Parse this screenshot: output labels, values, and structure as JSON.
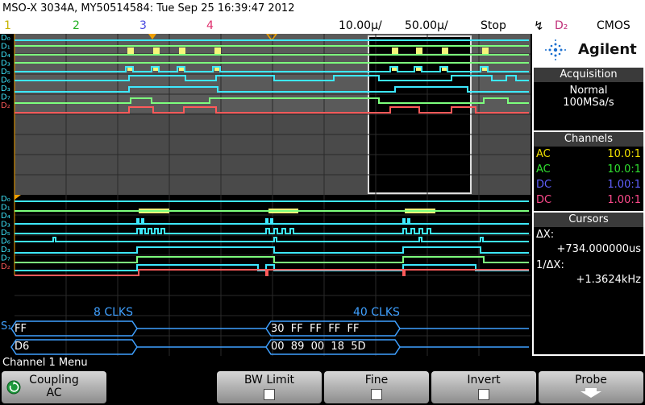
{
  "title_bar": {
    "text": "MSO-X 3034A, MY50514584: Tue Sep 25 16:39:47 2012"
  },
  "header": {
    "channels": [
      "1",
      "2",
      "3",
      "4"
    ],
    "channel_colors": [
      "#f0e000",
      "#30e030",
      "#6060ff",
      "#ff4a8c"
    ],
    "timebase": "10.00µ/",
    "delay": "50.00µ/",
    "run_state": "Stop",
    "trigger_symbol": "↯",
    "trigger_source": "D₂",
    "logic_family": "CMOS"
  },
  "digital_labels_upper": [
    "D₀",
    "D₁",
    "D₄",
    "D₃",
    "D₅",
    "D₆",
    "D₃",
    "D₇",
    "D₂"
  ],
  "digital_labels_lower": [
    "D₀",
    "D₁",
    "D₄",
    "D₃",
    "D₅",
    "D₆",
    "D₃",
    "D₇",
    "D₂"
  ],
  "brand": {
    "logo_text": "Agilent"
  },
  "acquisition": {
    "heading": "Acquisition",
    "mode": "Normal",
    "rate": "100MSa/s"
  },
  "channels_panel": {
    "heading": "Channels",
    "rows": [
      {
        "coupling": "AC",
        "probe": "10.0:1",
        "color": "#f0e000"
      },
      {
        "coupling": "AC",
        "probe": "10.0:1",
        "color": "#30e030"
      },
      {
        "coupling": "DC",
        "probe": "1.00:1",
        "color": "#6060ff"
      },
      {
        "coupling": "DC",
        "probe": "1.00:1",
        "color": "#ff4a8c"
      }
    ]
  },
  "cursors_panel": {
    "heading": "Cursors",
    "dx_label": "ΔX:",
    "dx_value": "+734.000000us",
    "inv_label": "1/ΔX:",
    "inv_value": "+1.3624kHz"
  },
  "bus": {
    "label": "S₁",
    "annotation_left": "8 CLKS",
    "annotation_right": "40 CLKS",
    "row1_left": "FF",
    "row1_right": "30  FF  FF  FF  FF",
    "row2_left": "D6",
    "row2_right": "00  89  00  18  5D"
  },
  "menu": {
    "title": "Channel 1 Menu"
  },
  "softkeys": [
    {
      "label": "Coupling",
      "value": "AC"
    },
    {
      "label": "BW Limit"
    },
    {
      "label": "Fine"
    },
    {
      "label": "Invert"
    },
    {
      "label": "Probe"
    }
  ]
}
